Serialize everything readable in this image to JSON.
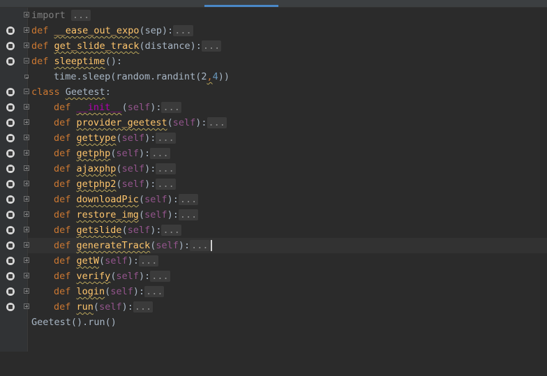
{
  "editor": {
    "lines": [
      {
        "kw": "import",
        "ell": "..."
      },
      {
        "kw": "def",
        "fn": "__ease_out_expo",
        "args": "(sep):",
        "ell": "..."
      },
      {
        "kw": "def",
        "fn": "get_slide_track",
        "args": "(distance):",
        "ell": "..."
      },
      {
        "kw": "def",
        "fn": "sleeptime",
        "args": "():"
      },
      {
        "text": "time.sleep(random.randint(2",
        "num": "4",
        "tail": "))",
        "comma": ","
      },
      {
        "kw": "class",
        "name": "Geetest",
        "tail": ":"
      },
      {
        "kw": "def",
        "fn": "__init__",
        "self": "self",
        "ell": "..."
      },
      {
        "kw": "def",
        "fn": "provider_geetest",
        "self": "self",
        "ell": "..."
      },
      {
        "kw": "def",
        "fn": "gettype",
        "self": "self",
        "ell": "..."
      },
      {
        "kw": "def",
        "fn": "getphp",
        "self": "self",
        "ell": "..."
      },
      {
        "kw": "def",
        "fn": "ajaxphp",
        "self": "self",
        "ell": "..."
      },
      {
        "kw": "def",
        "fn": "getphp2",
        "self": "self",
        "ell": "..."
      },
      {
        "kw": "def",
        "fn": "downloadPic",
        "self": "self",
        "ell": "..."
      },
      {
        "kw": "def",
        "fn": "restore_img",
        "self": "self",
        "ell": "..."
      },
      {
        "kw": "def",
        "fn": "getslide",
        "self": "self",
        "ell": "..."
      },
      {
        "kw": "def",
        "fn": "generateTrack",
        "self": "self",
        "ell": "..."
      },
      {
        "kw": "def",
        "fn": "getW",
        "self": "self",
        "ell": "..."
      },
      {
        "kw": "def",
        "fn": "verify",
        "self": "self",
        "ell": "..."
      },
      {
        "kw": "def",
        "fn": "login",
        "self": "self",
        "ell": "..."
      },
      {
        "kw": "def",
        "fn": "run",
        "self": "self",
        "ell": "..."
      },
      {
        "text": "Geetest().run()"
      }
    ],
    "paren_open": "(",
    "paren_close_colon": "):",
    "colon": ":"
  },
  "colors": {
    "background": "#2b2b2b",
    "keyword": "#cc7832",
    "function": "#ffc66d",
    "self": "#94558d",
    "magic": "#b200b2",
    "number": "#6897bb",
    "active_tab": "#4a88c7"
  }
}
